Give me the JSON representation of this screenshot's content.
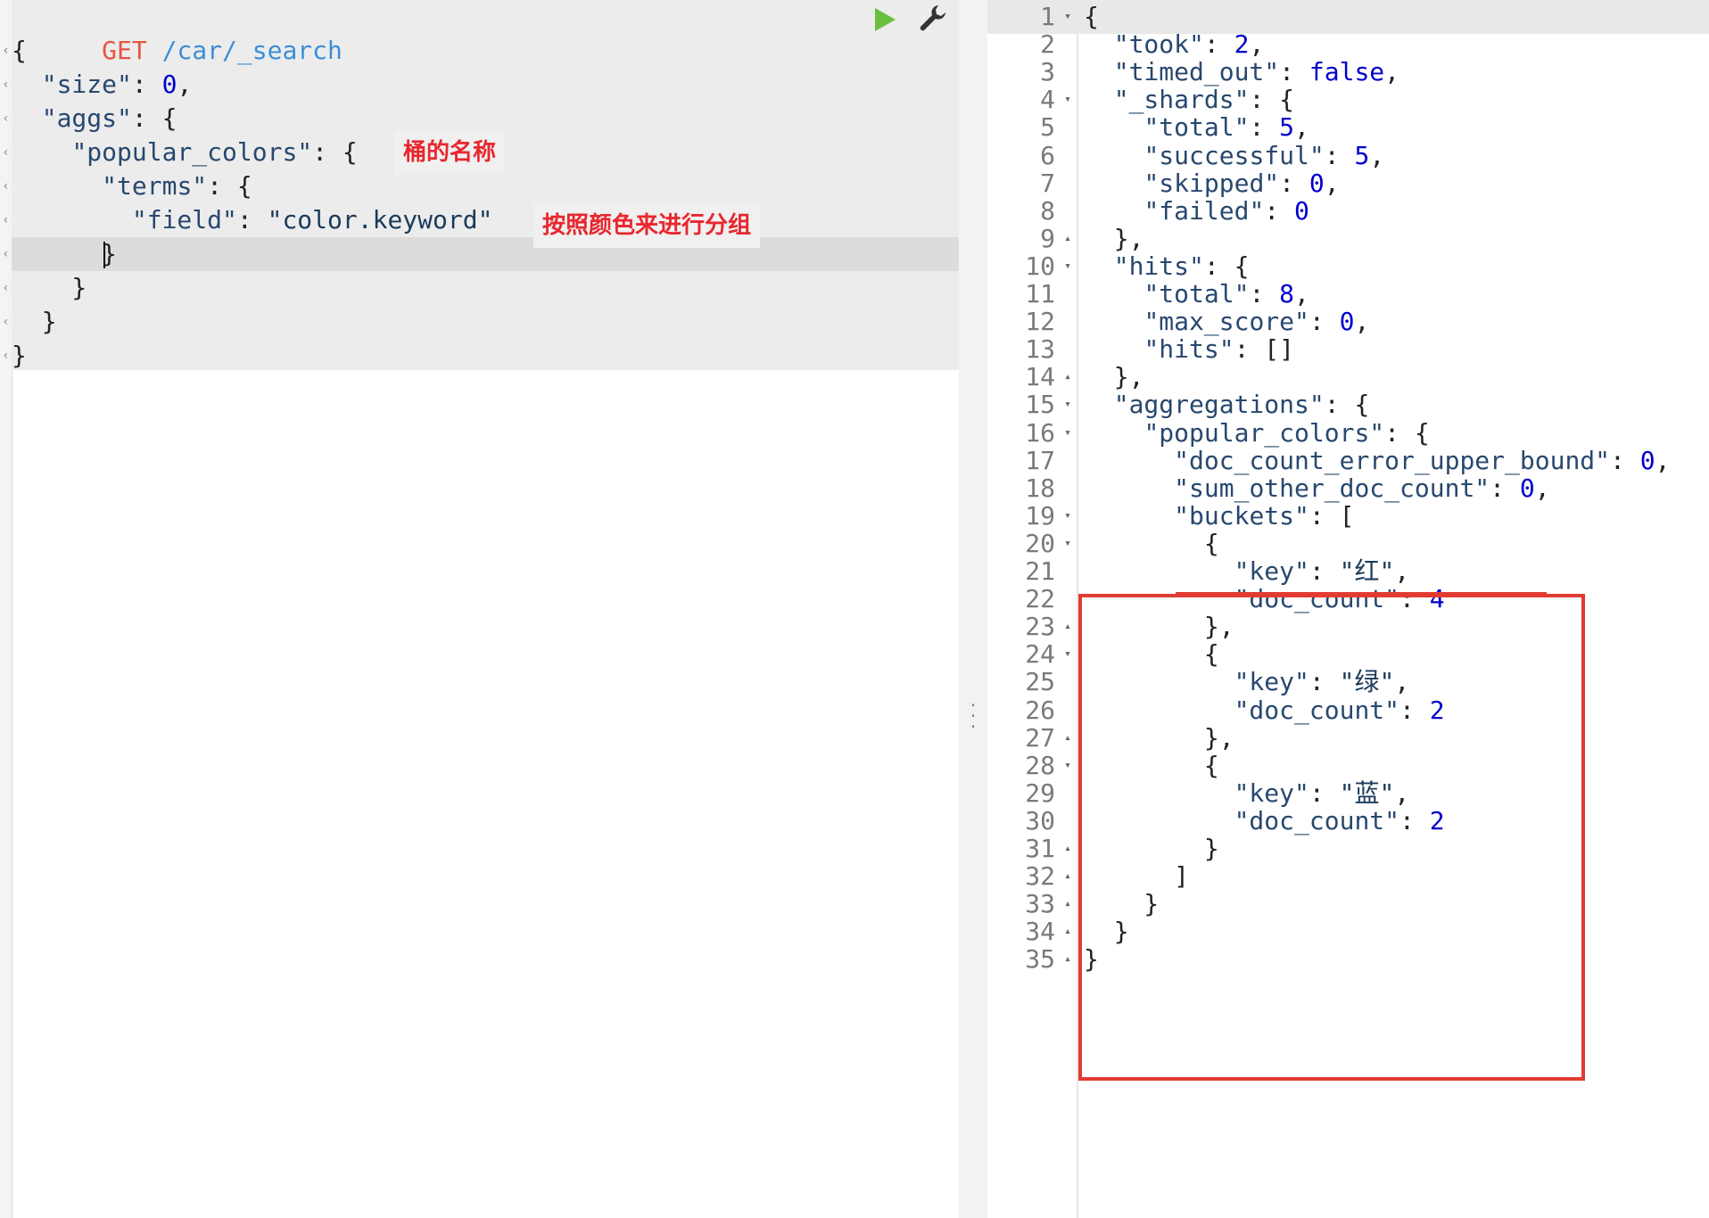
{
  "request": {
    "method": "GET",
    "url": "/car/_search",
    "lines": [
      [
        {
          "t": "{",
          "c": "punc"
        }
      ],
      [
        {
          "t": "  ",
          "c": "punc"
        },
        {
          "t": "\"size\"",
          "c": "key"
        },
        {
          "t": ": ",
          "c": "punc"
        },
        {
          "t": "0",
          "c": "num"
        },
        {
          "t": ",",
          "c": "punc"
        }
      ],
      [
        {
          "t": "  ",
          "c": "punc"
        },
        {
          "t": "\"aggs\"",
          "c": "key"
        },
        {
          "t": ": {",
          "c": "punc"
        }
      ],
      [
        {
          "t": "    ",
          "c": "punc"
        },
        {
          "t": "\"popular_colors\"",
          "c": "key"
        },
        {
          "t": ": {",
          "c": "punc"
        }
      ],
      [
        {
          "t": "      ",
          "c": "punc"
        },
        {
          "t": "\"terms\"",
          "c": "key"
        },
        {
          "t": ": {",
          "c": "punc"
        }
      ],
      [
        {
          "t": "        ",
          "c": "punc"
        },
        {
          "t": "\"field\"",
          "c": "key"
        },
        {
          "t": ": ",
          "c": "punc"
        },
        {
          "t": "\"color.keyword\"",
          "c": "str"
        }
      ],
      [
        {
          "t": "      ",
          "c": "punc"
        },
        {
          "t": "}",
          "c": "punc",
          "caret": true
        }
      ],
      [
        {
          "t": "    }",
          "c": "punc"
        }
      ],
      [
        {
          "t": "  }",
          "c": "punc"
        }
      ],
      [
        {
          "t": "}",
          "c": "punc"
        }
      ]
    ],
    "annotations": {
      "bucket_name": "桶的名称",
      "group_by_color": "按照颜色来进行分组"
    }
  },
  "response": {
    "lines": [
      {
        "n": "1",
        "f": "▾",
        "tokens": [
          {
            "t": "{",
            "c": "punc"
          }
        ]
      },
      {
        "n": "2",
        "f": "",
        "tokens": [
          {
            "t": "  ",
            "c": "punc"
          },
          {
            "t": "\"took\"",
            "c": "key"
          },
          {
            "t": ": ",
            "c": "punc"
          },
          {
            "t": "2",
            "c": "num"
          },
          {
            "t": ",",
            "c": "punc"
          }
        ]
      },
      {
        "n": "3",
        "f": "",
        "tokens": [
          {
            "t": "  ",
            "c": "punc"
          },
          {
            "t": "\"timed_out\"",
            "c": "key"
          },
          {
            "t": ": ",
            "c": "punc"
          },
          {
            "t": "false",
            "c": "bool"
          },
          {
            "t": ",",
            "c": "punc"
          }
        ]
      },
      {
        "n": "4",
        "f": "▾",
        "tokens": [
          {
            "t": "  ",
            "c": "punc"
          },
          {
            "t": "\"_shards\"",
            "c": "key"
          },
          {
            "t": ": {",
            "c": "punc"
          }
        ]
      },
      {
        "n": "5",
        "f": "",
        "tokens": [
          {
            "t": "    ",
            "c": "punc"
          },
          {
            "t": "\"total\"",
            "c": "key"
          },
          {
            "t": ": ",
            "c": "punc"
          },
          {
            "t": "5",
            "c": "num"
          },
          {
            "t": ",",
            "c": "punc"
          }
        ]
      },
      {
        "n": "6",
        "f": "",
        "tokens": [
          {
            "t": "    ",
            "c": "punc"
          },
          {
            "t": "\"successful\"",
            "c": "key"
          },
          {
            "t": ": ",
            "c": "punc"
          },
          {
            "t": "5",
            "c": "num"
          },
          {
            "t": ",",
            "c": "punc"
          }
        ]
      },
      {
        "n": "7",
        "f": "",
        "tokens": [
          {
            "t": "    ",
            "c": "punc"
          },
          {
            "t": "\"skipped\"",
            "c": "key"
          },
          {
            "t": ": ",
            "c": "punc"
          },
          {
            "t": "0",
            "c": "num"
          },
          {
            "t": ",",
            "c": "punc"
          }
        ]
      },
      {
        "n": "8",
        "f": "",
        "tokens": [
          {
            "t": "    ",
            "c": "punc"
          },
          {
            "t": "\"failed\"",
            "c": "key"
          },
          {
            "t": ": ",
            "c": "punc"
          },
          {
            "t": "0",
            "c": "num"
          }
        ]
      },
      {
        "n": "9",
        "f": "▴",
        "tokens": [
          {
            "t": "  },",
            "c": "punc"
          }
        ]
      },
      {
        "n": "10",
        "f": "▾",
        "tokens": [
          {
            "t": "  ",
            "c": "punc"
          },
          {
            "t": "\"hits\"",
            "c": "key"
          },
          {
            "t": ": {",
            "c": "punc"
          }
        ]
      },
      {
        "n": "11",
        "f": "",
        "tokens": [
          {
            "t": "    ",
            "c": "punc"
          },
          {
            "t": "\"total\"",
            "c": "key"
          },
          {
            "t": ": ",
            "c": "punc"
          },
          {
            "t": "8",
            "c": "num"
          },
          {
            "t": ",",
            "c": "punc"
          }
        ]
      },
      {
        "n": "12",
        "f": "",
        "tokens": [
          {
            "t": "    ",
            "c": "punc"
          },
          {
            "t": "\"max_score\"",
            "c": "key"
          },
          {
            "t": ": ",
            "c": "punc"
          },
          {
            "t": "0",
            "c": "num"
          },
          {
            "t": ",",
            "c": "punc"
          }
        ]
      },
      {
        "n": "13",
        "f": "",
        "tokens": [
          {
            "t": "    ",
            "c": "punc"
          },
          {
            "t": "\"hits\"",
            "c": "key"
          },
          {
            "t": ": []",
            "c": "punc"
          }
        ]
      },
      {
        "n": "14",
        "f": "▴",
        "tokens": [
          {
            "t": "  },",
            "c": "punc"
          }
        ]
      },
      {
        "n": "15",
        "f": "▾",
        "tokens": [
          {
            "t": "  ",
            "c": "punc"
          },
          {
            "t": "\"aggregations\"",
            "c": "key"
          },
          {
            "t": ": {",
            "c": "punc"
          }
        ]
      },
      {
        "n": "16",
        "f": "▾",
        "tokens": [
          {
            "t": "    ",
            "c": "punc"
          },
          {
            "t": "\"popular_colors\"",
            "c": "key"
          },
          {
            "t": ": {",
            "c": "punc"
          }
        ]
      },
      {
        "n": "17",
        "f": "",
        "tokens": [
          {
            "t": "      ",
            "c": "punc"
          },
          {
            "t": "\"doc_count_error_upper_bound\"",
            "c": "key"
          },
          {
            "t": ": ",
            "c": "punc"
          },
          {
            "t": "0",
            "c": "num"
          },
          {
            "t": ",",
            "c": "punc"
          }
        ]
      },
      {
        "n": "18",
        "f": "",
        "tokens": [
          {
            "t": "      ",
            "c": "punc"
          },
          {
            "t": "\"sum_other_doc_count\"",
            "c": "key"
          },
          {
            "t": ": ",
            "c": "punc"
          },
          {
            "t": "0",
            "c": "num"
          },
          {
            "t": ",",
            "c": "punc"
          }
        ]
      },
      {
        "n": "19",
        "f": "▾",
        "tokens": [
          {
            "t": "      ",
            "c": "punc"
          },
          {
            "t": "\"buckets\"",
            "c": "key"
          },
          {
            "t": ": [",
            "c": "punc"
          }
        ]
      },
      {
        "n": "20",
        "f": "▾",
        "tokens": [
          {
            "t": "        {",
            "c": "punc"
          }
        ]
      },
      {
        "n": "21",
        "f": "",
        "tokens": [
          {
            "t": "          ",
            "c": "punc"
          },
          {
            "t": "\"key\"",
            "c": "key"
          },
          {
            "t": ": ",
            "c": "punc"
          },
          {
            "t": "\"红\"",
            "c": "str"
          },
          {
            "t": ",",
            "c": "punc"
          }
        ]
      },
      {
        "n": "22",
        "f": "",
        "tokens": [
          {
            "t": "          ",
            "c": "punc"
          },
          {
            "t": "\"doc_count\"",
            "c": "key"
          },
          {
            "t": ": ",
            "c": "punc"
          },
          {
            "t": "4",
            "c": "num"
          }
        ]
      },
      {
        "n": "23",
        "f": "▴",
        "tokens": [
          {
            "t": "        },",
            "c": "punc"
          }
        ]
      },
      {
        "n": "24",
        "f": "▾",
        "tokens": [
          {
            "t": "        {",
            "c": "punc"
          }
        ]
      },
      {
        "n": "25",
        "f": "",
        "tokens": [
          {
            "t": "          ",
            "c": "punc"
          },
          {
            "t": "\"key\"",
            "c": "key"
          },
          {
            "t": ": ",
            "c": "punc"
          },
          {
            "t": "\"绿\"",
            "c": "str"
          },
          {
            "t": ",",
            "c": "punc"
          }
        ]
      },
      {
        "n": "26",
        "f": "",
        "tokens": [
          {
            "t": "          ",
            "c": "punc"
          },
          {
            "t": "\"doc_count\"",
            "c": "key"
          },
          {
            "t": ": ",
            "c": "punc"
          },
          {
            "t": "2",
            "c": "num"
          }
        ]
      },
      {
        "n": "27",
        "f": "▴",
        "tokens": [
          {
            "t": "        },",
            "c": "punc"
          }
        ]
      },
      {
        "n": "28",
        "f": "▾",
        "tokens": [
          {
            "t": "        {",
            "c": "punc"
          }
        ]
      },
      {
        "n": "29",
        "f": "",
        "tokens": [
          {
            "t": "          ",
            "c": "punc"
          },
          {
            "t": "\"key\"",
            "c": "key"
          },
          {
            "t": ": ",
            "c": "punc"
          },
          {
            "t": "\"蓝\"",
            "c": "str"
          },
          {
            "t": ",",
            "c": "punc"
          }
        ]
      },
      {
        "n": "30",
        "f": "",
        "tokens": [
          {
            "t": "          ",
            "c": "punc"
          },
          {
            "t": "\"doc_count\"",
            "c": "key"
          },
          {
            "t": ": ",
            "c": "punc"
          },
          {
            "t": "2",
            "c": "num"
          }
        ]
      },
      {
        "n": "31",
        "f": "▴",
        "tokens": [
          {
            "t": "        }",
            "c": "punc"
          }
        ]
      },
      {
        "n": "32",
        "f": "▴",
        "tokens": [
          {
            "t": "      ]",
            "c": "punc"
          }
        ]
      },
      {
        "n": "33",
        "f": "▴",
        "tokens": [
          {
            "t": "    }",
            "c": "punc"
          }
        ]
      },
      {
        "n": "34",
        "f": "▴",
        "tokens": [
          {
            "t": "  }",
            "c": "punc"
          }
        ]
      },
      {
        "n": "35",
        "f": "▴",
        "tokens": [
          {
            "t": "}",
            "c": "punc"
          }
        ]
      }
    ]
  },
  "icons": {
    "run": "play-icon",
    "settings": "wrench-icon",
    "resize": "vertical-dots-icon"
  },
  "colors": {
    "method": "#e8553f",
    "url": "#3b8ed8",
    "key": "#28486e",
    "number": "#0000cd",
    "run_button": "#6bbf3f",
    "highlight_box": "#e23b32",
    "annotation_text": "#e8272e"
  }
}
